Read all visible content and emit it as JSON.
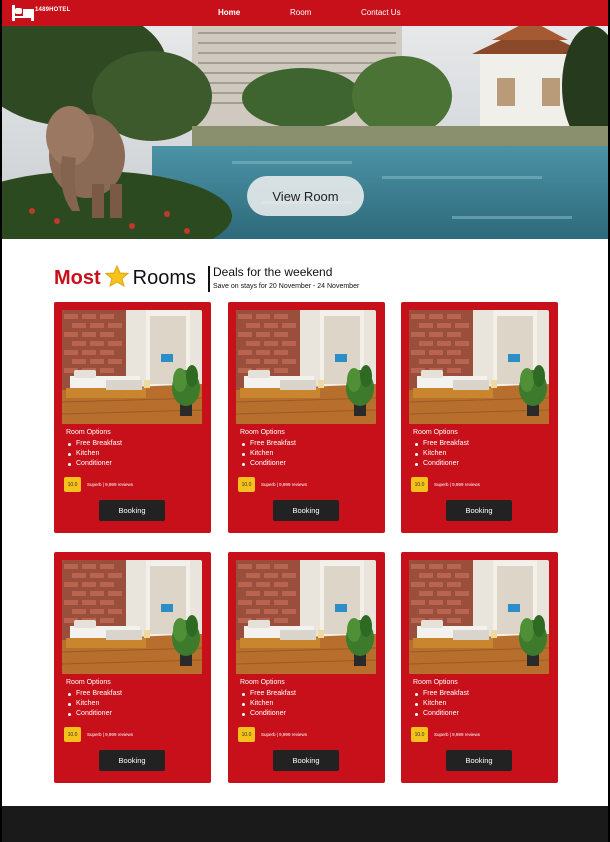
{
  "nav": {
    "brand": "1489HOTEL",
    "links": [
      {
        "label": "Home",
        "active": true
      },
      {
        "label": "Room",
        "active": false
      },
      {
        "label": "Contact Us",
        "active": false
      }
    ]
  },
  "hero": {
    "button_label": "View Room"
  },
  "section": {
    "title_most": "Most",
    "title_star": "⭐",
    "title_rooms": "Rooms",
    "deal_title": "Deals for the weekend",
    "deal_subtitle": "Save on stays for 20 November - 24 November"
  },
  "cards": [
    {
      "options_title": "Room Options",
      "features": [
        "Free Breakfast",
        "Kitchen",
        "Conditioner"
      ],
      "score": "10.0",
      "review": "Superb | 9,999 reviews",
      "button": "Booking"
    },
    {
      "options_title": "Room Options",
      "features": [
        "Free Breakfast",
        "Kitchen",
        "Conditioner"
      ],
      "score": "10.0",
      "review": "Superb | 9,999 reviews",
      "button": "Booking"
    },
    {
      "options_title": "Room Options",
      "features": [
        "Free Breakfast",
        "Kitchen",
        "Conditioner"
      ],
      "score": "10.0",
      "review": "Superb | 9,999 reviews",
      "button": "Booking"
    },
    {
      "options_title": "Room Options",
      "features": [
        "Free Breakfast",
        "Kitchen",
        "Conditioner"
      ],
      "score": "10.0",
      "review": "Superb | 9,999 reviews",
      "button": "Booking"
    },
    {
      "options_title": "Room Options",
      "features": [
        "Free Breakfast",
        "Kitchen",
        "Conditioner"
      ],
      "score": "10.0",
      "review": "Superb | 9,999 reviews",
      "button": "Booking"
    },
    {
      "options_title": "Room Options",
      "features": [
        "Free Breakfast",
        "Kitchen",
        "Conditioner"
      ],
      "score": "10.0",
      "review": "Superb | 9,999 reviews",
      "button": "Booking"
    }
  ],
  "colors": {
    "brand_red": "#c8101a",
    "score_yellow": "#f4c21a",
    "button_dark": "#222222",
    "footer": "#1a1a1a"
  },
  "icons": {
    "logo": "bed-icon",
    "feature_bullet": "bullet-icon",
    "title": "star-icon"
  }
}
